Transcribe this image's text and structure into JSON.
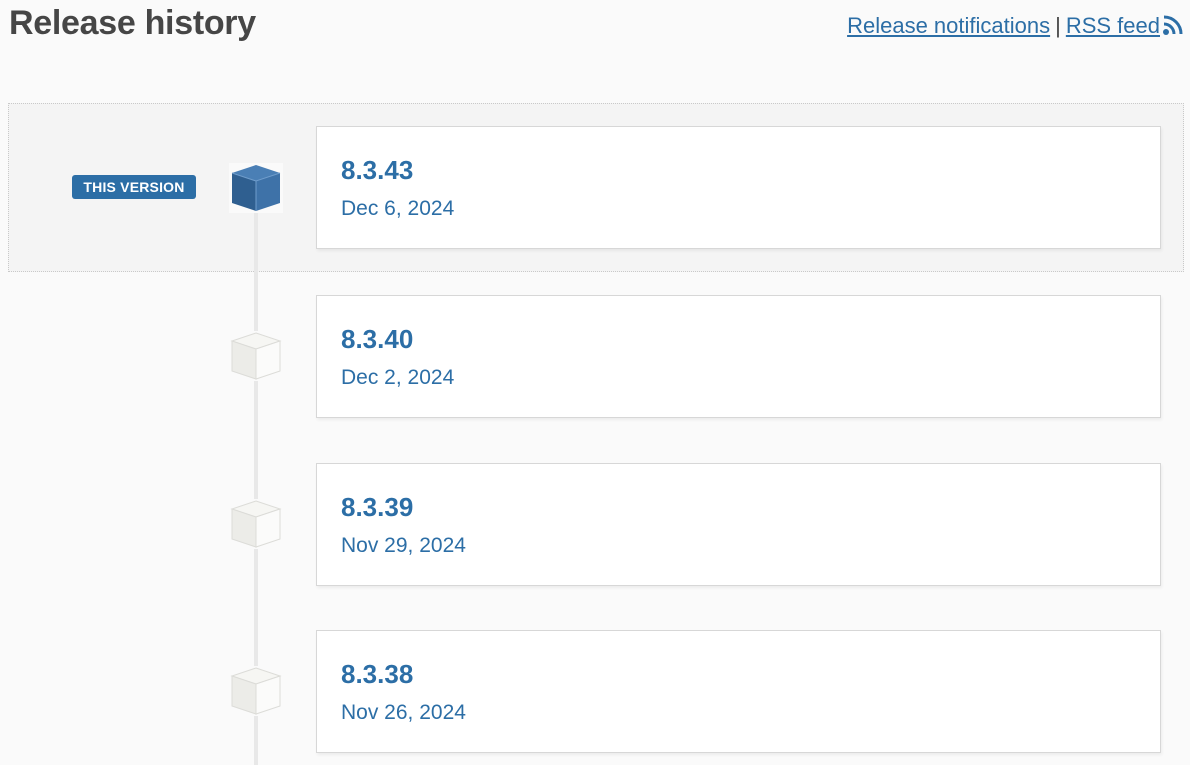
{
  "header": {
    "title": "Release history",
    "notifications_label": "Release notifications",
    "separator": "|",
    "rss_label": "RSS feed",
    "rss_icon": "rss-icon"
  },
  "current_badge": "THIS VERSION",
  "colors": {
    "accent": "#2c6ea6",
    "current_cube": "#3a6a9c",
    "inactive_cube": "#efefea"
  },
  "releases": [
    {
      "version": "8.3.43",
      "date": "Dec 6, 2024",
      "current": true
    },
    {
      "version": "8.3.40",
      "date": "Dec 2, 2024",
      "current": false
    },
    {
      "version": "8.3.39",
      "date": "Nov 29, 2024",
      "current": false
    },
    {
      "version": "8.3.38",
      "date": "Nov 26, 2024",
      "current": false
    }
  ]
}
